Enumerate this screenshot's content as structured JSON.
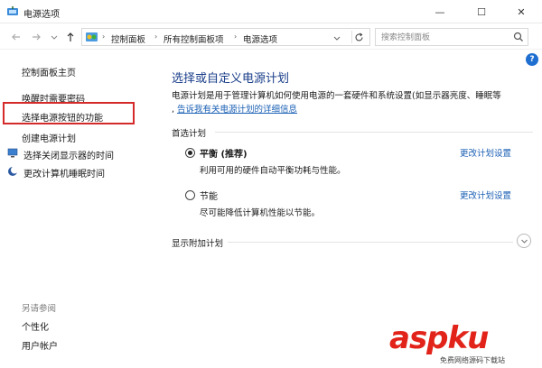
{
  "window": {
    "title": "电源选项",
    "minimize_glyph": "—",
    "maximize_glyph": "☐",
    "close_glyph": "✕"
  },
  "address": {
    "crumbs": [
      "控制面板",
      "所有控制面板项",
      "电源选项"
    ],
    "search_placeholder": "搜索控制面板"
  },
  "sidebar": {
    "items": [
      {
        "label": "控制面板主页"
      },
      {
        "label": "唤醒时需要密码"
      },
      {
        "label": "选择电源按钮的功能"
      },
      {
        "label": "创建电源计划"
      },
      {
        "label": "选择关闭显示器的时间",
        "icon": "monitor-icon"
      },
      {
        "label": "更改计算机睡眠时间",
        "icon": "moon-icon"
      }
    ],
    "see_also_title": "另请参阅",
    "see_also": [
      {
        "label": "个性化"
      },
      {
        "label": "用户帐户"
      }
    ]
  },
  "main": {
    "title": "选择或自定义电源计划",
    "description": "电源计划是用于管理计算机如何使用电源的一套硬件和系统设置(如显示器亮度、睡眠等",
    "description_link": "告诉我有关电源计划的详细信息",
    "preferred_section": "首选计划",
    "plans": [
      {
        "name": "平衡 (推荐)",
        "desc": "利用可用的硬件自动平衡功耗与性能。",
        "link": "更改计划设置",
        "selected": true
      },
      {
        "name": "节能",
        "desc": "尽可能降低计算机性能以节能。",
        "link": "更改计划设置",
        "selected": false
      }
    ],
    "additional_section": "显示附加计划"
  },
  "watermark": {
    "logo": "aspku",
    "sub": "免费网络源码下载站"
  },
  "colors": {
    "accent": "#1a5fb4",
    "title_blue": "#1a3e8a",
    "highlight_red": "#d42a2a",
    "watermark_red": "#e2231a"
  }
}
